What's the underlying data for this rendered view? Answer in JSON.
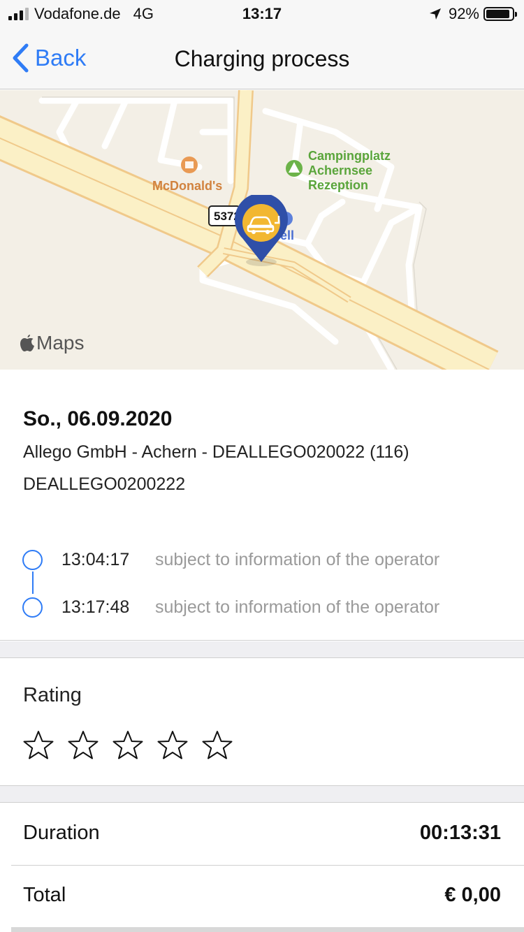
{
  "status_bar": {
    "carrier": "Vodafone.de",
    "network": "4G",
    "time": "13:17",
    "battery": "92%",
    "battery_level": 0.92
  },
  "nav": {
    "back_label": "Back",
    "title": "Charging process"
  },
  "map": {
    "poi_mcdonalds": "McDonald's",
    "poi_camping_line1": "Campingplatz",
    "poi_camping_line2": "Achernsee",
    "poi_camping_line3": "Rezeption",
    "poi_shell": "ell",
    "road_number": "5372",
    "attribution": "Maps",
    "accent_pin": "#2f4fa8",
    "accent_pin_inner": "#f2b731"
  },
  "session": {
    "date": "So., 06.09.2020",
    "operator": "Allego GmbH - Achern - DEALLEGO020022 (116)",
    "evse_id": "DEALLEGO0200222",
    "start_time": "13:04:17",
    "end_time": "13:17:48",
    "start_note": "subject to information of the operator",
    "end_note": "subject to information of the operator"
  },
  "rating": {
    "label": "Rating",
    "value": 0,
    "max": 5
  },
  "summary": {
    "duration_label": "Duration",
    "duration_value": "00:13:31",
    "total_label": "Total",
    "total_value": "€ 0,00"
  },
  "colors": {
    "accent": "#2f7cf6",
    "muted_text": "#9a9a9a"
  }
}
